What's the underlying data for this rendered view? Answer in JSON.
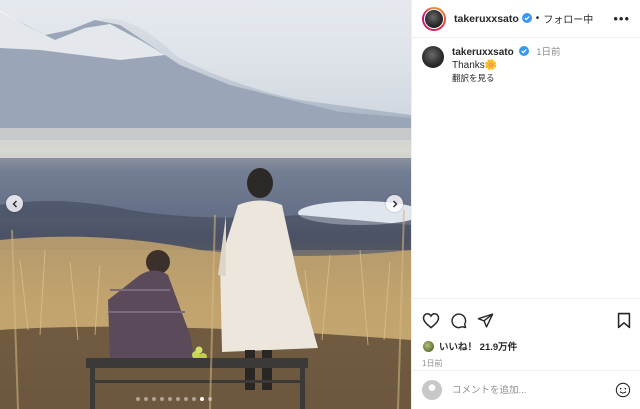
{
  "header": {
    "username": "takeruxxsato",
    "separator": "•",
    "follow_status": "フォロー中",
    "more": "•••"
  },
  "caption": {
    "username": "takeruxxsato",
    "time": "1日前",
    "text": "Thanks🌼",
    "translate": "翻訳を見る"
  },
  "engagement": {
    "likes_label": "いいね！",
    "likes_count": "21.9万件",
    "time": "1日前"
  },
  "comment_box": {
    "placeholder": "コメントを追加..."
  },
  "carousel": {
    "total": 10,
    "active_index": 8
  },
  "icons": {
    "like": "heart-icon",
    "comment": "comment-icon",
    "share": "paper-plane-icon",
    "save": "bookmark-icon",
    "prev": "chevron-left-icon",
    "next": "chevron-right-icon",
    "emoji": "smiley-icon",
    "verified": "verified-badge-icon"
  },
  "colors": {
    "verified": "#3897f0",
    "secondary_text": "#8e8e8e",
    "divider": "#efefef"
  }
}
